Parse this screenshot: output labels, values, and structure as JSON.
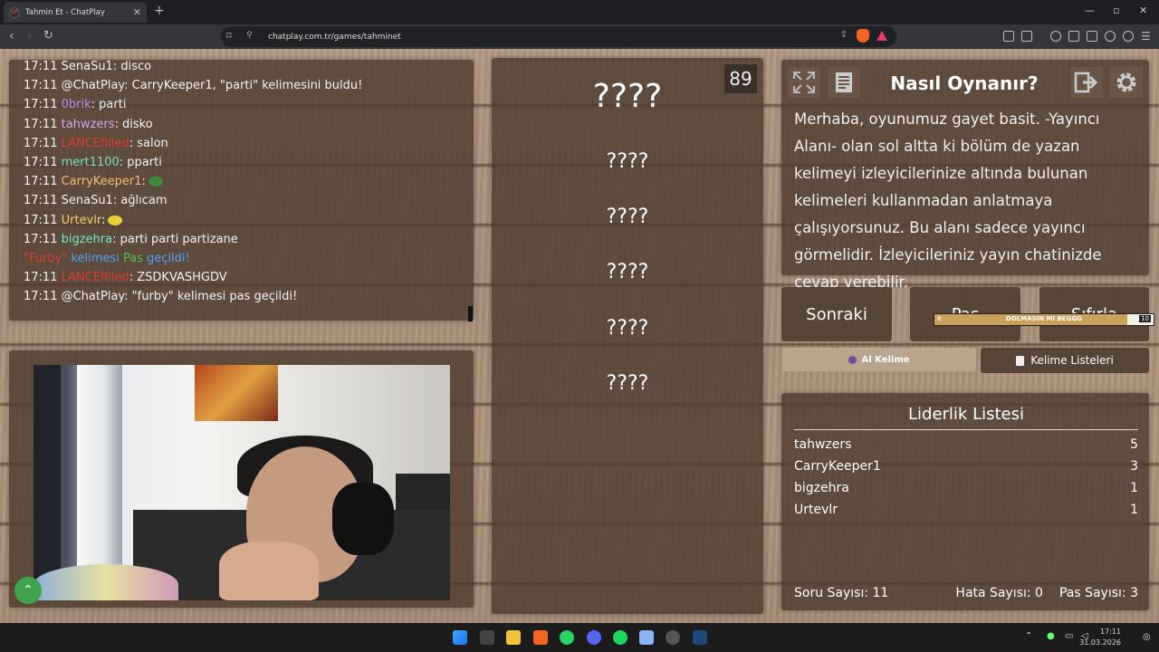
{
  "browser": {
    "tab_title": "Tahmin Et - ChatPlay",
    "favicon_text": "CP",
    "url": "chatplay.com.tr/games/tahminet"
  },
  "chat": {
    "messages": [
      {
        "time": "17:11",
        "user": "SenaSu1",
        "text": ": disco",
        "color": "#f4f4f4"
      },
      {
        "time": "17:11",
        "user": "@ChatPlay",
        "text": ": CarryKeeper1, \"parti\" kelimesini buldu!",
        "color": "#f4f4f4"
      },
      {
        "time": "17:11",
        "user": "0brik",
        "text": ": parti",
        "color": "#c08cf0"
      },
      {
        "time": "17:11",
        "user": "tahwzers",
        "text": ": disko",
        "color": "#d8a6f5"
      },
      {
        "time": "17:11",
        "user": "LANCEfilled",
        "text": ": salon",
        "color": "#e03a3a"
      },
      {
        "time": "17:11",
        "user": "mert1100",
        "text": ": pparti",
        "color": "#7be0b8"
      },
      {
        "time": "17:11",
        "user": "CarryKeeper1",
        "text": ":",
        "color": "#f0c070"
      },
      {
        "time": "17:11",
        "user": "SenaSu1",
        "text": ": ağlıcam",
        "color": "#f4f4f4"
      },
      {
        "time": "17:11",
        "user": "Urtevlr",
        "text": ":",
        "color": "#f0d070"
      },
      {
        "time": "17:11",
        "user": "bigzehra",
        "text": ": parti parti partizane",
        "color": "#6cf0c0"
      },
      {
        "time": "",
        "user": "",
        "text": "",
        "color": "#f4f4f4",
        "system": true
      },
      {
        "time": "17:11",
        "user": "LANCEfilled",
        "text": ": ZSDKVASHGDV",
        "color": "#e03a3a"
      },
      {
        "time": "17:11",
        "user": "@ChatPlay",
        "text": ": \"furby\" kelimesi pas geçildi!",
        "color": "#f4f4f4"
      }
    ],
    "system_line": {
      "w1": "\"Furby\"",
      "w2": "kelimesi",
      "w3": "Pas",
      "w4": "geçildi!"
    }
  },
  "game": {
    "timer": "89",
    "words": [
      "????",
      "????",
      "????",
      "????",
      "????",
      "????"
    ]
  },
  "howto": {
    "title": "Nasıl Oynanır?",
    "text": "Merhaba, oyunumuz gayet basit. -Yayıncı Alanı- olan sol altta ki bölüm de yazan kelimeyi izleyicilerinize altında bulunan kelimeleri kullanmadan anlatmaya çalışıyorsunuz. Bu alanı sadece yayıncı görmelidir. İzleyicileriniz yayın chatinizde cevap verebilir."
  },
  "actions": {
    "next": "Sonraki",
    "pass": "Pas",
    "reset": "Sıfırla",
    "progress_label": "DOLMASIN MI BEGGG",
    "progress_low": "8",
    "progress_high": "10",
    "progress_fraction": 0.88,
    "al_kelime": "Al Kelime",
    "kelime_listeleri": "Kelime Listeleri"
  },
  "leaderboard": {
    "title": "Liderlik Listesi",
    "rows": [
      {
        "name": "tahwzers",
        "score": "5"
      },
      {
        "name": "CarryKeeper1",
        "score": "3"
      },
      {
        "name": "bigzehra",
        "score": "1"
      },
      {
        "name": "Urtevlr",
        "score": "1"
      }
    ]
  },
  "stats": {
    "questions": "Soru Sayısı: 11",
    "errors": "Hata Sayısı: 0",
    "passes": "Pas Sayısı: 3"
  },
  "taskbar": {
    "time": "17:11",
    "date": "31.03.2026"
  }
}
